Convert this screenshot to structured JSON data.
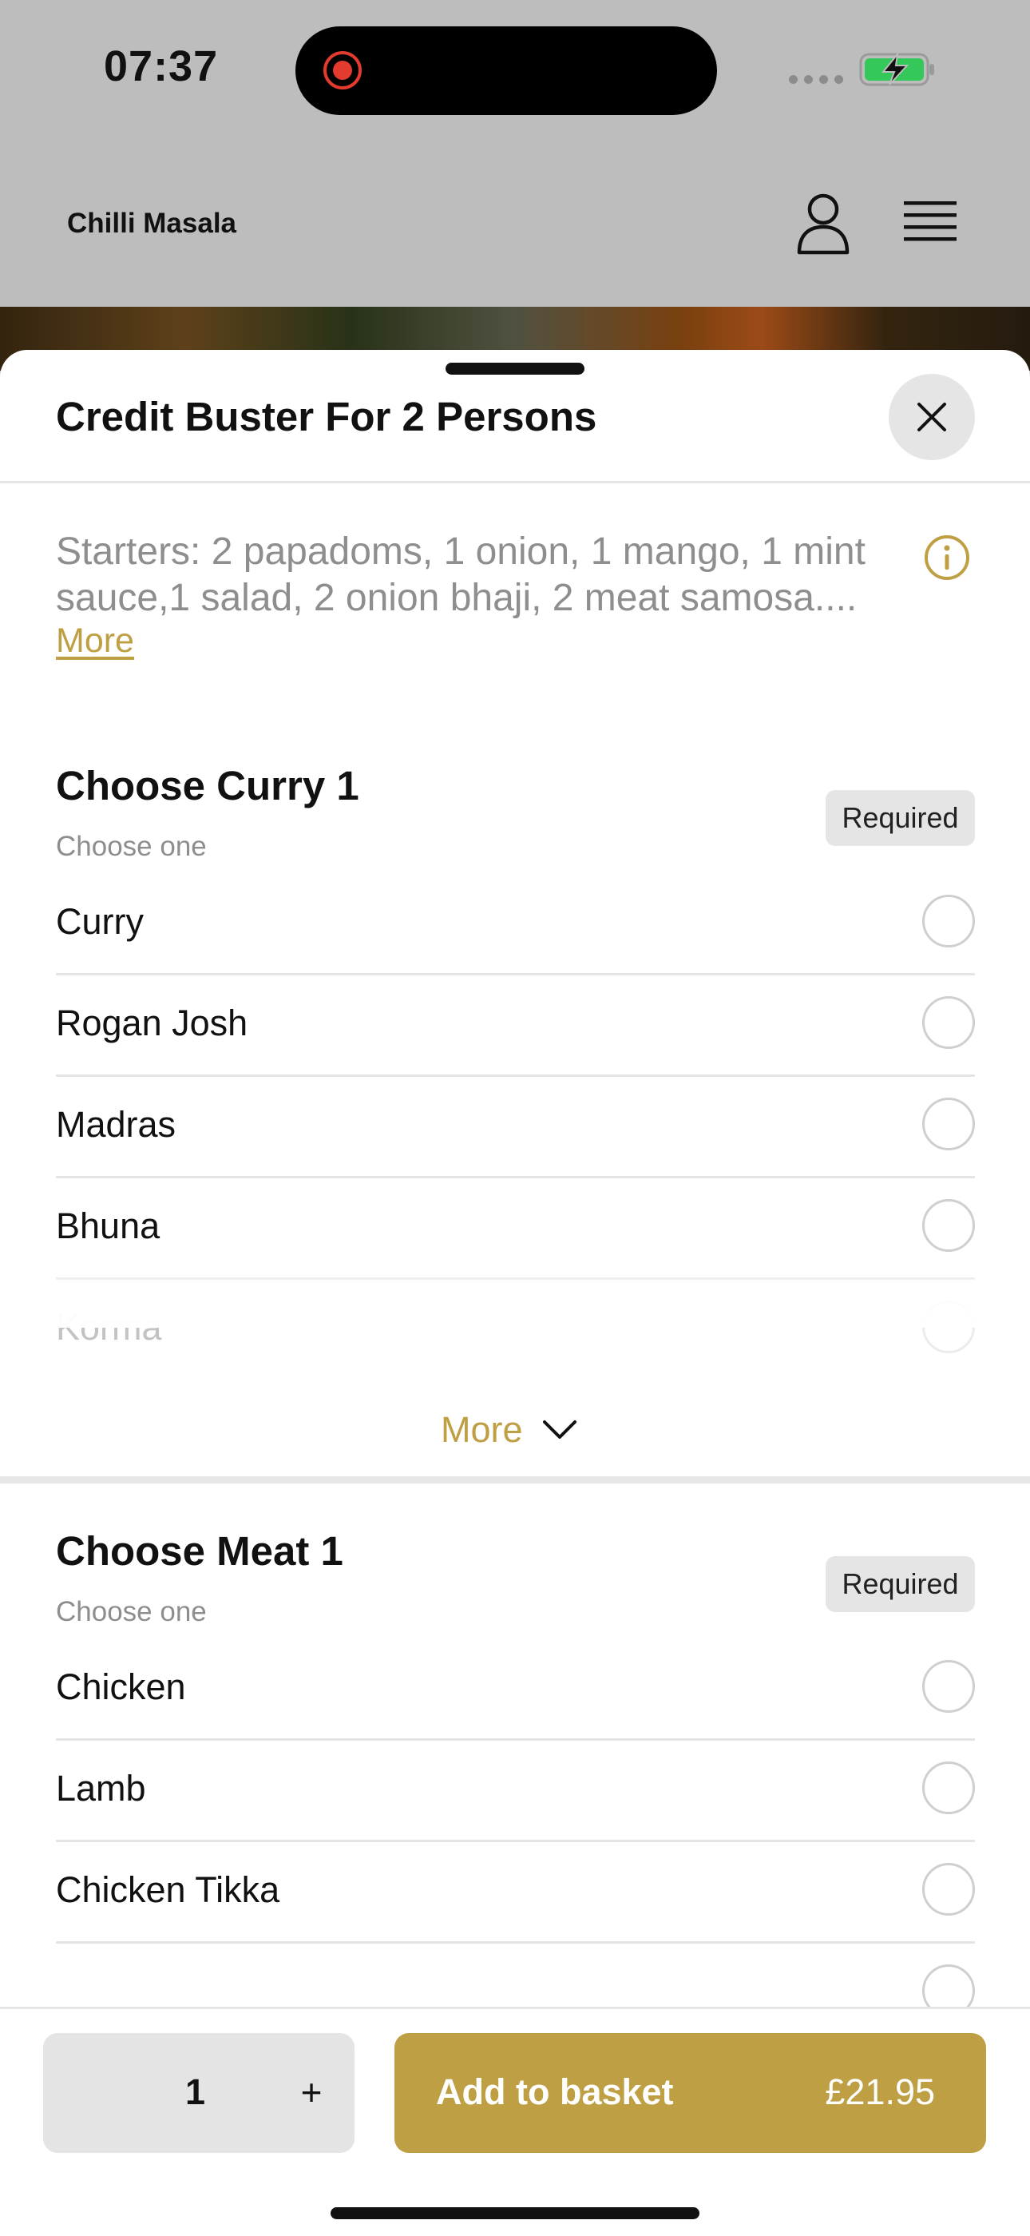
{
  "status_bar": {
    "time": "07:37"
  },
  "header": {
    "brand": "Chilli Masala",
    "account_icon": "person-icon",
    "menu_icon": "hamburger-menu-icon"
  },
  "sheet": {
    "title": "Credit Buster For 2 Persons",
    "close_icon": "close-icon",
    "description": "Starters: 2 papadoms, 1 onion, 1 mango, 1 mint sauce,1 salad, 2 onion bhaji, 2 meat samosa....",
    "description_more": "More",
    "info_icon": "info-icon"
  },
  "sections": [
    {
      "title": "Choose Curry 1",
      "subtitle": "Choose one",
      "badge": "Required",
      "options": [
        "Curry",
        "Rogan Josh",
        "Madras",
        "Bhuna",
        "Korma"
      ],
      "more_label": "More"
    },
    {
      "title": "Choose Meat 1",
      "subtitle": "Choose one",
      "badge": "Required",
      "options": [
        "Chicken",
        "Lamb",
        "Chicken Tikka"
      ]
    }
  ],
  "bottom_bar": {
    "quantity": "1",
    "plus_label": "+",
    "add_label": "Add to basket",
    "price": "£21.95"
  },
  "colors": {
    "accent": "#bf9f43",
    "header_bg": "#bdbdbd",
    "recording": "#e33b2e",
    "battery": "#34c759"
  }
}
